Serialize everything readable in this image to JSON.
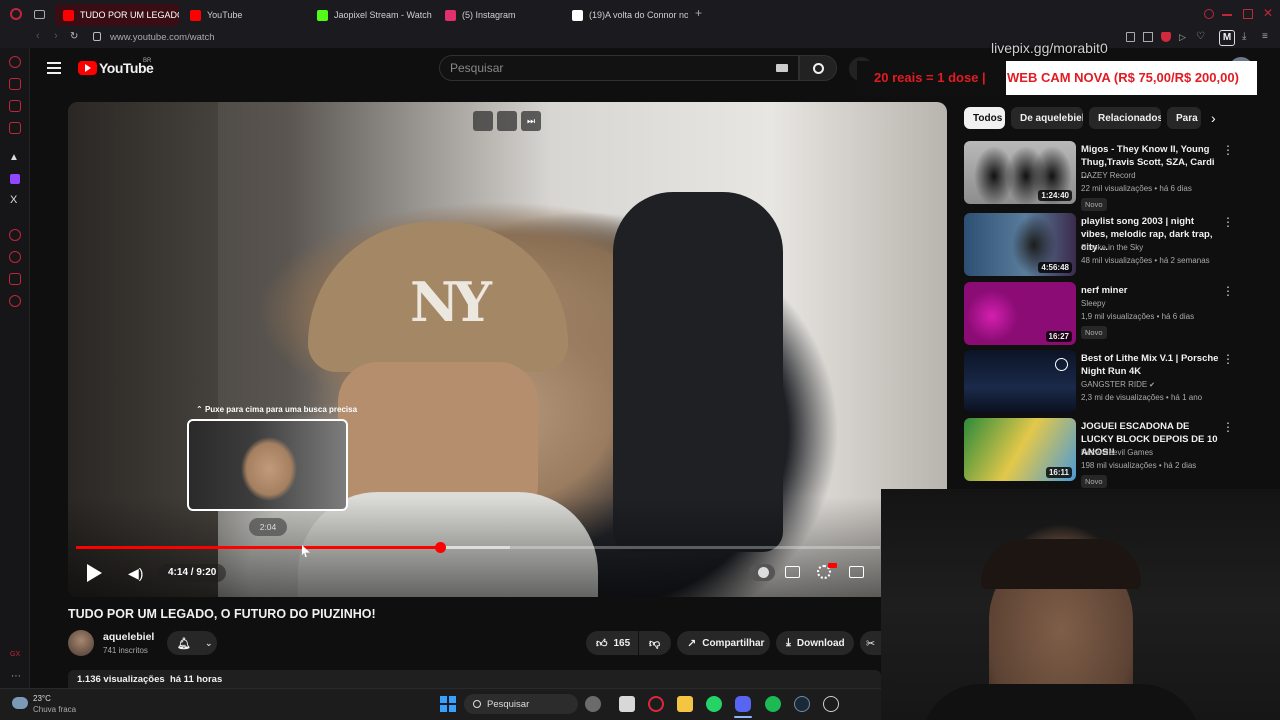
{
  "browser": {
    "tabs": [
      {
        "label": "TUDO POR UM LEGADO,",
        "active": true,
        "color": "#ff0000"
      },
      {
        "label": "YouTube",
        "active": false,
        "color": "#ff0000"
      },
      {
        "label": "Jaopixel Stream - Watch",
        "active": false,
        "color": "#53fc18"
      },
      {
        "label": "(5) Instagram",
        "active": false,
        "color": "#e1306c"
      },
      {
        "label": "(19)A volta do Connor no",
        "active": false,
        "color": "#ffffff"
      }
    ],
    "address": "www.youtube.com/watch",
    "accent": "#c0263a"
  },
  "header": {
    "logo_text": "YouTube",
    "region": "BR",
    "search_placeholder": "Pesquisar"
  },
  "player": {
    "seek_tooltip_hint": "Puxe para cima para uma busca precisa",
    "preview_time": "2:04",
    "time_display": "4:14 / 9:20",
    "progress_fraction": 0.453,
    "buffer_fraction": 0.54,
    "hover_fraction": 0.286
  },
  "video": {
    "title": "TUDO POR UM LEGADO, O FUTURO DO PIUZINHO!",
    "channel": "aquelebiel",
    "subscribers": "741 inscritos",
    "likes": "165",
    "share_label": "Compartilhar",
    "download_label": "Download",
    "views_line": "1.136 visualizações",
    "age": "há 11 horas"
  },
  "chips": [
    "Todos",
    "De aquelebiel",
    "Relacionados",
    "Para"
  ],
  "recommendations": [
    {
      "title": "Migos - They Know II, Young Thug,Travis Scott, SZA, Cardi ...",
      "channel": "DAZEY Record",
      "meta": "22 mil visualizações • há 6 dias",
      "badge": "Novo",
      "duration": "1:24:40",
      "verified": false
    },
    {
      "title": "playlist song 2003 | night vibes, melodic rap, dark trap, city ...",
      "channel": "Smoke in the Sky",
      "meta": "48 mil visualizações • há 2 semanas",
      "badge": "",
      "duration": "4:56:48",
      "verified": false
    },
    {
      "title": "nerf miner",
      "channel": "Sleepy",
      "meta": "1,9 mil visualizações • há 6 dias",
      "badge": "Novo",
      "duration": "16:27",
      "verified": false
    },
    {
      "title": "Best of Lithe Mix V.1 | Porsche Night Run 4K",
      "channel": "GANGSTER RIDE",
      "meta": "2,3 mi de visualizações • há 1 ano",
      "badge": "",
      "duration": "",
      "verified": true
    },
    {
      "title": "JOGUEI ESCADONA DE LUCKY BLOCK DEPOIS DE 10 ANOS!!",
      "channel": "Rezendeevil Games",
      "meta": "198 mil visualizações • há 2 dias",
      "badge": "Novo",
      "duration": "16:11",
      "verified": false
    }
  ],
  "overlay": {
    "url_text": "livepix.gg/morabit0",
    "donation_red": "20 reais = 1 dose |",
    "donation_white": "WEB CAM NOVA (R$ 75,00/R$ 200,00)"
  },
  "taskbar": {
    "temperature": "23°C",
    "weather": "Chuva fraca",
    "search_label": "Pesquisar"
  }
}
